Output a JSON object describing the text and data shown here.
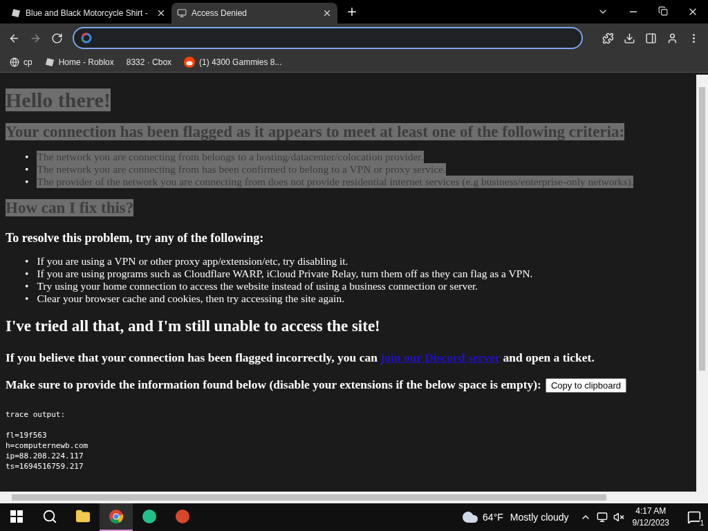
{
  "tabs": [
    {
      "title": "Blue and Black Motorcycle Shirt -",
      "selected": false
    },
    {
      "title": "Access Denied",
      "selected": true
    }
  ],
  "bookmarks": [
    {
      "label": "cp",
      "kind": "globe"
    },
    {
      "label": "Home - Roblox",
      "kind": "roblox"
    },
    {
      "label": "8332 · Cbox",
      "kind": "none"
    },
    {
      "label": "(1) 4300 Gammies 8...",
      "kind": "reddit"
    }
  ],
  "page": {
    "blocks": [
      {
        "kind": "h1",
        "text": "Hello there!",
        "highlighted": true
      },
      {
        "kind": "h2",
        "text": "Your connection has been flagged as it appears to meet at least one of the following criteria:",
        "highlighted": true
      },
      {
        "kind": "list",
        "highlighted": true,
        "marker": "•",
        "items": [
          "The network you are connecting from belongs to a hosting/datacenter/colocation provider.",
          "The network you are connecting from has been confirmed to belong to a VPN or proxy service.",
          "The provider of the network you are connecting from does not provide residential internet services (e.g business/enterprise-only networks)."
        ]
      },
      {
        "kind": "h2",
        "text": "How can I fix this?",
        "highlighted": true
      },
      {
        "kind": "h3",
        "text": "To resolve this problem, try any of the following:",
        "highlighted": false
      },
      {
        "kind": "list",
        "highlighted": false,
        "marker": "•",
        "items": [
          "If you are using a VPN or other proxy app/extension/etc, try disabling it.",
          "If you are using programs such as Cloudflare WARP, iCloud Private Relay, turn them off as they can flag as a VPN.",
          "Try using your home connection to access the website instead of using a business connection or server.",
          "Clear your browser cache and cookies, then try accessing the site again."
        ]
      },
      {
        "kind": "h2big",
        "text": "I've tried all that, and I'm still unable to access the site!",
        "highlighted": false
      },
      {
        "kind": "link_line",
        "before": "If you believe that your connection has been flagged incorrectly, you can",
        "link": "join our Discord server",
        "after": "and open a ticket.",
        "highlighted": false
      },
      {
        "kind": "button_line",
        "text": "Make sure to provide the information found below (disable your extensions if the below space is empty):",
        "button": "Copy to clipboard",
        "highlighted": false
      },
      {
        "kind": "trace",
        "header": "trace output:",
        "lines": [
          "fl=19f563",
          "h=computernewb.com",
          "ip=88.208.224.117",
          "ts=1694516759.217"
        ],
        "highlighted": false
      }
    ]
  },
  "taskbar": {
    "apps": [
      {
        "kind": "search",
        "selected": false
      },
      {
        "kind": "explorer",
        "selected": false
      },
      {
        "kind": "chrome",
        "selected": true
      },
      {
        "kind": "green",
        "selected": false
      },
      {
        "kind": "red",
        "selected": false
      }
    ],
    "temperature": "64°F",
    "weather": "Mostly cloudy",
    "time": "4:17 AM",
    "date": "9/12/2023",
    "notifications": "1"
  }
}
